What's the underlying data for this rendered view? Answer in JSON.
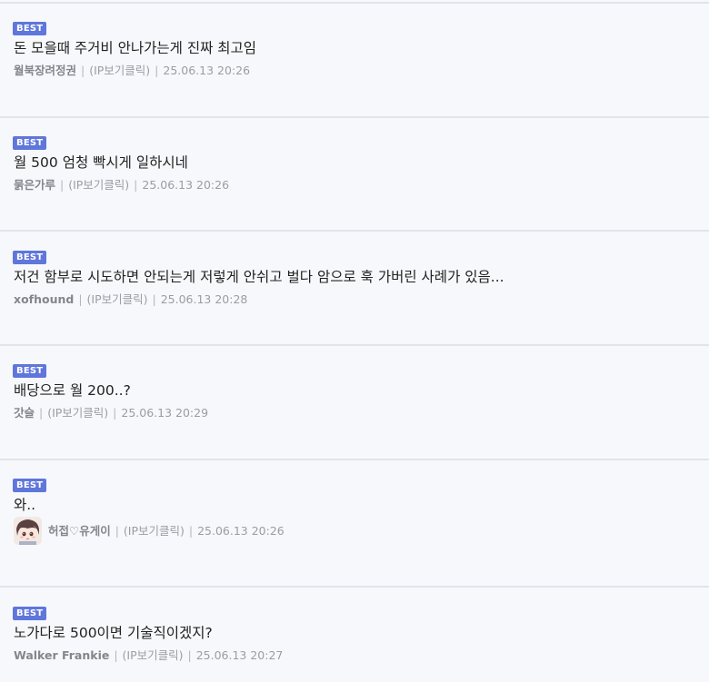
{
  "badge_label": "BEST",
  "separator": "|",
  "comments": [
    {
      "text": "돈 모을때 주거비 안나가는게 진짜 최고임",
      "author": "월북장려정권",
      "ip": "(IP보기클릭)",
      "datetime": "25.06.13 20:26"
    },
    {
      "text": "월 500 엄청 빡시게 일하시네",
      "author": "묽은가루",
      "ip": "(IP보기클릭)",
      "datetime": "25.06.13 20:26"
    },
    {
      "text": "저건 함부로 시도하면 안되는게 저렇게 안쉬고 벌다 암으로 훅 가버린 사례가 있음...",
      "author": "xofhound",
      "ip": "(IP보기클릭)",
      "datetime": "25.06.13 20:28"
    },
    {
      "text": "배당으로 월 200..?",
      "author": "갓슬",
      "ip": "(IP보기클릭)",
      "datetime": "25.06.13 20:29"
    },
    {
      "text": "와..",
      "author": "허접♡유게이",
      "ip": "(IP보기클릭)",
      "datetime": "25.06.13 20:26",
      "avatar_icon": "anime-character-avatar"
    },
    {
      "text": "노가다로 500이면 기술직이겠지?",
      "author": "Walker Frankie",
      "ip": "(IP보기클릭)",
      "datetime": "25.06.13 20:27"
    }
  ],
  "colors": {
    "badge": "#5f76db",
    "background": "#f7f8fb",
    "separator": "#e1e4ea",
    "text": "#222222",
    "meta": "#9a9da3"
  }
}
